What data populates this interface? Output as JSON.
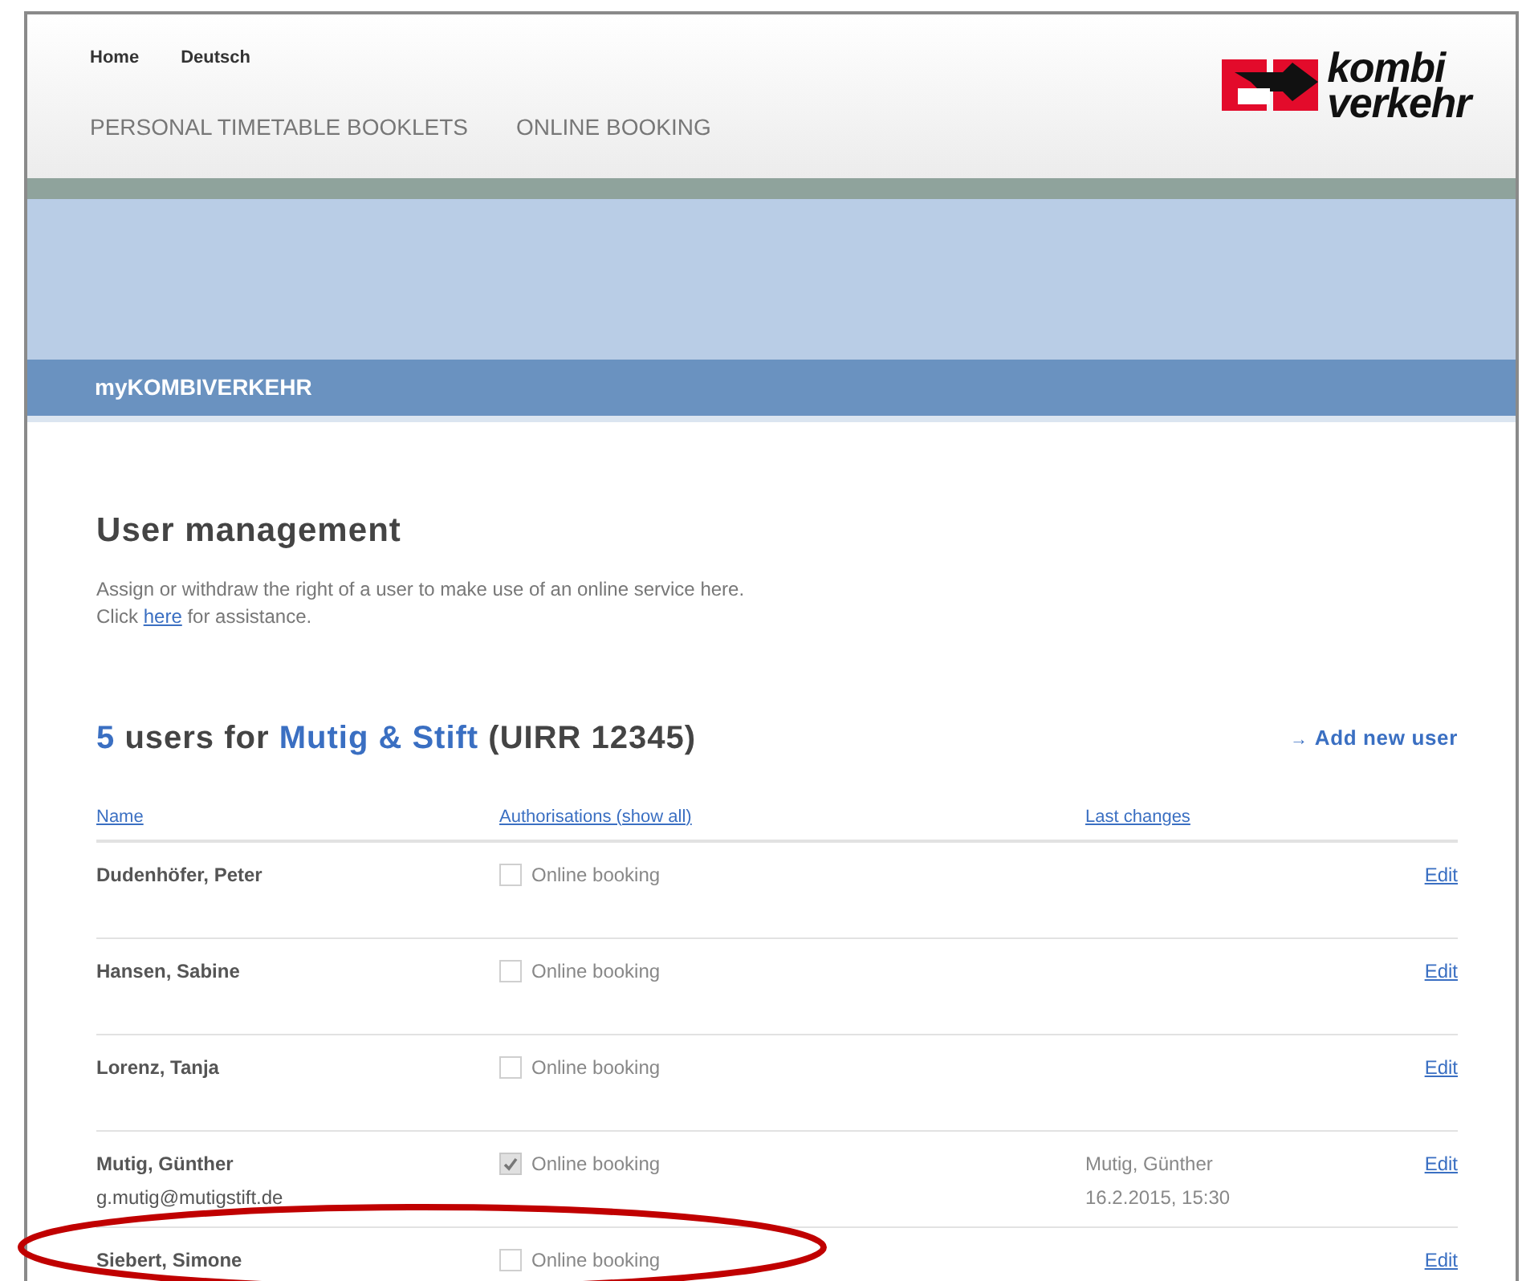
{
  "top_links": [
    "Home",
    "Deutsch"
  ],
  "main_nav": [
    "PERSONAL TIMETABLE BOOKLETS",
    "ONLINE BOOKING"
  ],
  "logo": {
    "line1": "kombi",
    "line2": "verkehr"
  },
  "section_bar": "myKOMBIVERKEHR",
  "page_title": "User management",
  "description": {
    "line1": "Assign or withdraw the right of a user to make use of an online service here.",
    "before_link": "Click",
    "link": "here",
    "after_link": "for assistance."
  },
  "users_heading": {
    "count": "5",
    "label": "users for",
    "company": "Mutig & Stift",
    "uirr": "(UIRR 12345)"
  },
  "add_user": {
    "icon": "→",
    "label": "Add new user"
  },
  "table": {
    "columns": [
      "Name",
      "Authorisations (show all)",
      "Last changes"
    ],
    "rows": [
      {
        "name": "Dudenhöfer, Peter",
        "authorisation": "Online booking",
        "checked": false,
        "edit": "Edit",
        "highlighted": false
      },
      {
        "name": "Hansen, Sabine",
        "authorisation": "Online booking",
        "checked": false,
        "edit": "Edit",
        "highlighted": false
      },
      {
        "name": "Lorenz, Tanja",
        "authorisation": "Online booking",
        "checked": false,
        "edit": "Edit",
        "highlighted": false
      },
      {
        "name": "Mutig, Günther",
        "email": "g.mutig@mutigstift.de",
        "authorisation": "Online booking",
        "checked": true,
        "changed_by": "Mutig, Günther",
        "changed_at": "16.2.2015, 15:30",
        "edit": "Edit",
        "highlighted": false
      },
      {
        "name": "Siebert, Simone",
        "authorisation": "Online booking",
        "checked": false,
        "edit": "Edit",
        "highlighted": true
      }
    ]
  }
}
